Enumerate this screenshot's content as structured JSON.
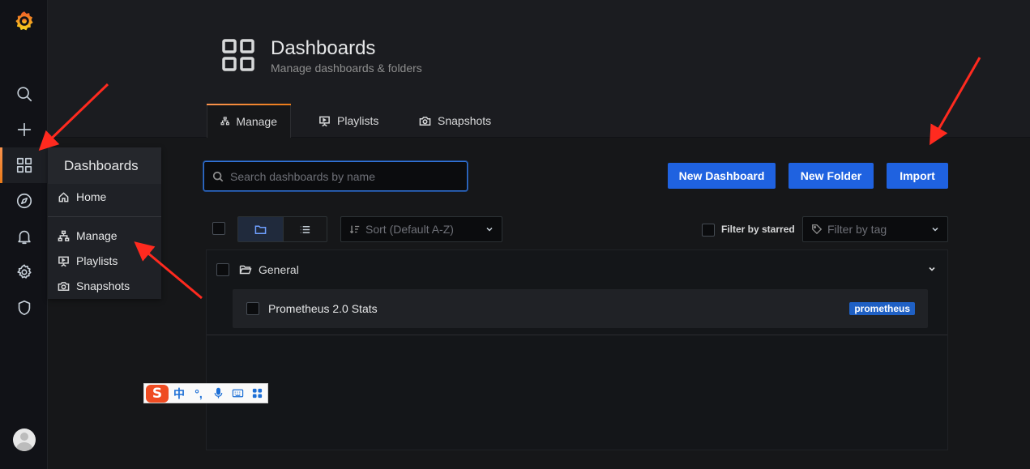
{
  "header": {
    "title": "Dashboards",
    "subtitle": "Manage dashboards & folders"
  },
  "tabs": [
    {
      "label": "Manage",
      "icon": "sitemap-icon",
      "active": true
    },
    {
      "label": "Playlists",
      "icon": "presentation-icon",
      "active": false
    },
    {
      "label": "Snapshots",
      "icon": "camera-icon",
      "active": false
    }
  ],
  "sidebar": {
    "items": [
      "grafana-logo",
      "search-icon",
      "plus-icon",
      "dashboards-icon",
      "compass-icon",
      "bell-icon",
      "gear-icon",
      "shield-icon"
    ],
    "active": "dashboards-icon"
  },
  "flyout": {
    "title": "Dashboards",
    "items": [
      {
        "label": "Home",
        "icon": "home-icon"
      },
      {
        "label": "Manage",
        "icon": "sitemap-icon"
      },
      {
        "label": "Playlists",
        "icon": "presentation-icon"
      },
      {
        "label": "Snapshots",
        "icon": "camera-icon"
      }
    ]
  },
  "search": {
    "placeholder": "Search dashboards by name",
    "value": ""
  },
  "actions": {
    "new_dashboard": "New Dashboard",
    "new_folder": "New Folder",
    "import": "Import"
  },
  "toolbar": {
    "sort_placeholder": "Sort (Default A-Z)",
    "filter_starred_label": "Filter by starred",
    "filter_tag_placeholder": "Filter by tag"
  },
  "folders": [
    {
      "name": "General",
      "dashboards": [
        {
          "name": "Prometheus 2.0 Stats",
          "tags": [
            "prometheus"
          ]
        }
      ]
    }
  ],
  "ime": {
    "logo": "S",
    "lang": "中",
    "punct": "°,"
  },
  "colors": {
    "accent": "#1f62e0",
    "tab_highlight": "#eb7b18",
    "tag": "#1f60c4",
    "annotation_arrow": "#ff2a1f"
  }
}
